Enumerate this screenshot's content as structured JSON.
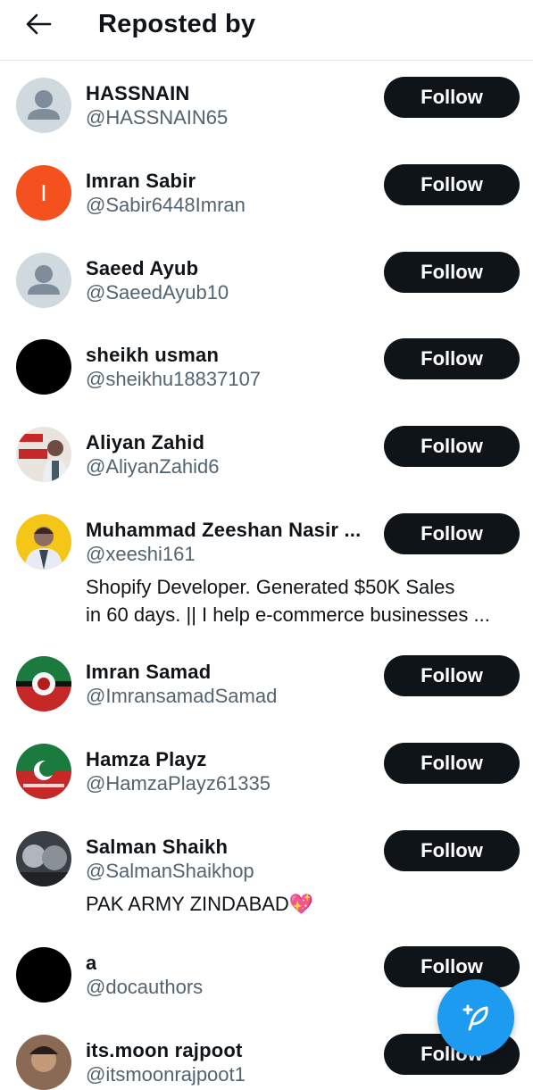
{
  "header": {
    "title": "Reposted by",
    "back_icon": "arrow-left-icon"
  },
  "users": [
    {
      "name": "HASSNAIN",
      "handle": "@HASSNAIN65",
      "bio": [],
      "follow_label": "Follow",
      "avatar": "default-avatar",
      "avatar_color": "#cfd9de"
    },
    {
      "name": "Imran Sabir",
      "handle": "@Sabir6448Imran",
      "bio": [],
      "follow_label": "Follow",
      "avatar": "letter-avatar",
      "avatar_letter": "I",
      "avatar_color": "#f4511e"
    },
    {
      "name": "Saeed Ayub",
      "handle": "@SaeedAyub10",
      "bio": [],
      "follow_label": "Follow",
      "avatar": "default-avatar",
      "avatar_color": "#cfd9de"
    },
    {
      "name": "sheikh usman",
      "handle": "@sheikhu18837107",
      "bio": [],
      "follow_label": "Follow",
      "avatar": "black-avatar",
      "avatar_color": "#000000"
    },
    {
      "name": "Aliyan Zahid",
      "handle": "@AliyanZahid6",
      "bio": [],
      "follow_label": "Follow",
      "avatar": "photo-avatar",
      "avatar_color": "#e9e4de"
    },
    {
      "name": "Muhammad Zeeshan Nasir ...",
      "handle": "@xeeshi161",
      "bio": [
        "Shopify Developer. Generated $50K Sales",
        "in 60 days. || I help e-commerce businesses ..."
      ],
      "follow_label": "Follow",
      "avatar": "photo-avatar",
      "avatar_color": "#f5c518"
    },
    {
      "name": "Imran Samad",
      "handle": "@ImransamadSamad",
      "bio": [],
      "follow_label": "Follow",
      "avatar": "flag-avatar",
      "avatar_color": "#1b7a3e"
    },
    {
      "name": "Hamza Playz",
      "handle": "@HamzaPlayz61335",
      "bio": [],
      "follow_label": "Follow",
      "avatar": "flag-avatar",
      "avatar_color": "#1b7a3e"
    },
    {
      "name": "Salman Shaikh",
      "handle": "@SalmanShaikhop",
      "bio": [
        "PAK ARMY ZINDABAD💖"
      ],
      "follow_label": "Follow",
      "avatar": "photo-avatar",
      "avatar_color": "#3a3f45"
    },
    {
      "name": "a",
      "handle": "@docauthors",
      "bio": [],
      "follow_label": "Follow",
      "avatar": "black-avatar",
      "avatar_color": "#000000"
    },
    {
      "name": "its.moon rajpoot",
      "handle": "@itsmoonrajpoot1",
      "bio": [],
      "follow_label": "Follow",
      "avatar": "photo-avatar",
      "avatar_color": "#8a6a55"
    }
  ],
  "fab": {
    "icon": "compose-feather-icon",
    "color": "#1d9bf0"
  },
  "accent": "#1d9bf0"
}
